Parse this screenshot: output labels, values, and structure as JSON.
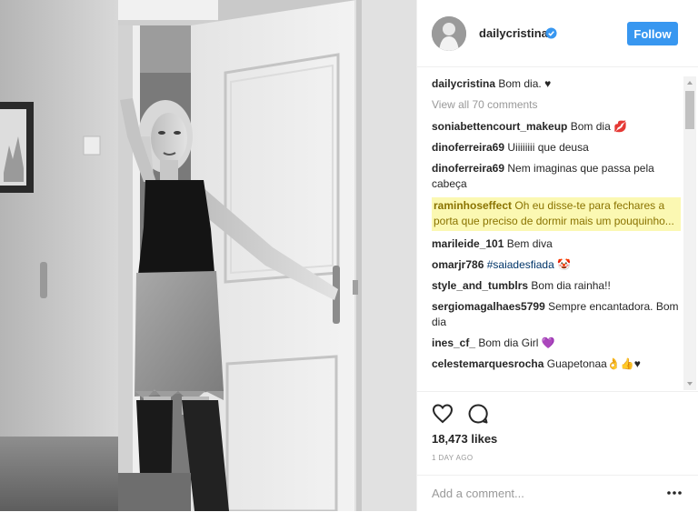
{
  "post": {
    "username": "dailycristina",
    "follow_label": "Follow"
  },
  "caption": {
    "user": "dailycristina",
    "text": "Bom dia. ♥"
  },
  "view_all": "View all 70 comments",
  "comments": [
    {
      "user": "soniabettencourt_makeup",
      "text": "Bom dia 💋"
    },
    {
      "user": "dinoferreira69",
      "text": "Uiiiiiiii que deusa"
    },
    {
      "user": "dinoferreira69",
      "text": "Nem imaginas que passa pela cabeça"
    },
    {
      "user": "raminhoseffect",
      "text": "Oh eu disse-te para fechares a porta que preciso de dormir mais um pouquinho..."
    },
    {
      "user": "marileide_101",
      "text": "Bem diva"
    },
    {
      "user": "omarjr786",
      "text": "#saiadesfiada 🤡"
    },
    {
      "user": "style_and_tumblrs",
      "text": "Bom dia rainha!!"
    },
    {
      "user": "sergiomagalhaes5799",
      "text": "Sempre encantadora. Bom dia"
    },
    {
      "user": "ines_cf_",
      "text": "Bom dia Girl 💜"
    },
    {
      "user": "celestemarquesrocha",
      "text": "Guapetonaa👌👍♥"
    }
  ],
  "likes": "18,473 likes",
  "time_ago": "1 DAY AGO",
  "add_comment_placeholder": "Add a comment...",
  "icons": {
    "heart": "heart-icon",
    "comment": "comment-icon",
    "more": "more-options-icon",
    "verified": "verified-badge-icon"
  },
  "colors": {
    "follow": "#3897f0",
    "highlight": "#fbf8b2"
  }
}
